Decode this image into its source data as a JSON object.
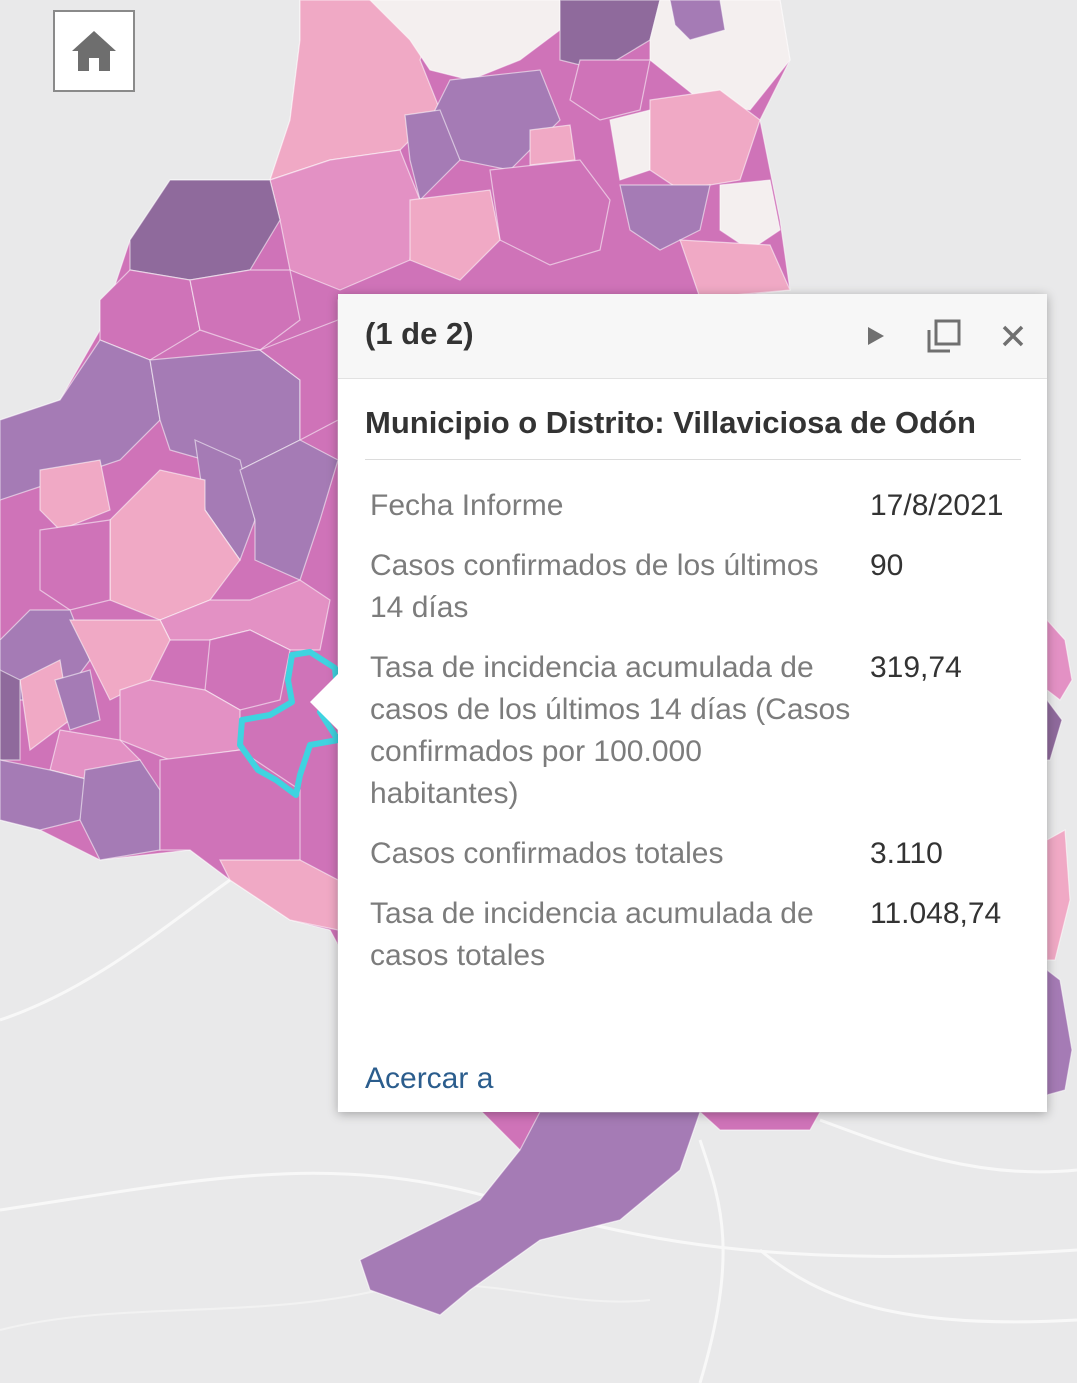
{
  "map": {
    "colors": {
      "background": "#e9e9ea",
      "lightest": "#f4efef",
      "light_pink": "#f0a9c5",
      "pink": "#e391c4",
      "magenta": "#cf73b8",
      "purple": "#a57bb5",
      "dark_purple": "#8f6a9c",
      "highlight": "#3fd3e0"
    },
    "home_icon": "home-icon"
  },
  "popup": {
    "count_label": "(1 de 2)",
    "next_icon": "play-icon",
    "maximize_icon": "maximize-icon",
    "close_icon": "close-icon",
    "title": "Municipio o Distrito: Villaviciosa de Odón",
    "rows": [
      {
        "label": "Fecha Informe",
        "value": "17/8/2021"
      },
      {
        "label": "Casos confirmados de los últimos 14 días",
        "value": "90"
      },
      {
        "label": "Tasa de incidencia acumulada de casos de los últimos 14 días (Casos confirmados por 100.000 habitantes)",
        "value": "319,74"
      },
      {
        "label": "Casos confirmados totales",
        "value": "3.110"
      },
      {
        "label": "Tasa de incidencia acumulada de casos totales",
        "value": "11.048,74"
      }
    ],
    "zoom_label": "Acercar a"
  }
}
